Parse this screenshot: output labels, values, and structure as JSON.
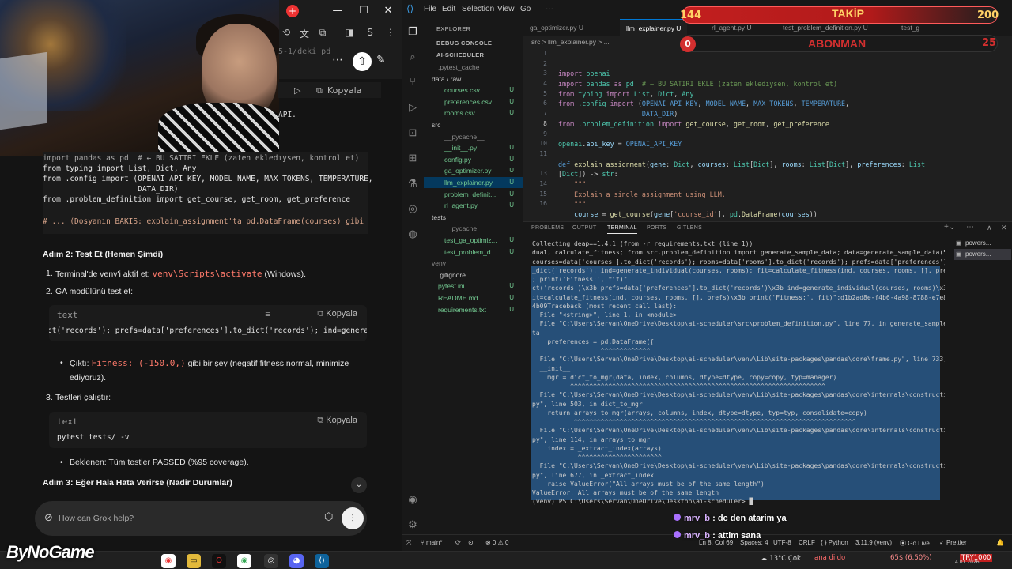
{
  "browser": {
    "win_min": "—",
    "win_max": "☐",
    "win_close": "✕",
    "fragment_pd": "5-1/deki pd",
    "fragment_api": "API.",
    "code1": {
      "copy_label": "Kopyala",
      "lines": [
        "import pandas as pd  # ← BU SATIRI EKLE (zaten ekledıysen, kontrol et)",
        "from typing import List, Dict, Any",
        "from .config import (OPENAI_API_KEY, MODEL_NAME, MAX_TOKENS, TEMPERATURE,",
        "                     DATA_DIR)",
        "from .problem_definition import get_course, get_room, get_preference"
      ],
      "comment": "# ... (Dosyanın BAKİS: explain_assignment'ta pd.DataFrame(courses) gibi yerle"
    },
    "step2": {
      "heading": "Adım 2: Test Et (Hemen Şimdi)",
      "item1_prefix": "Terminal'de venv'i aktif et:",
      "item1_code": "venv\\Scripts\\activate",
      "item1_suffix": "(Windows).",
      "item2": "GA modülünü test et:",
      "code_lang": "text",
      "copy_label": "Kopyala",
      "code_line": "ct('records'); prefs=data['preferences'].to_dict('records'); ind=generate_in",
      "bullet_prefix": "Çıktı:",
      "bullet_code": "Fitness: (-150.0,)",
      "bullet_suffix": "gibi bir şey (negatif fitness normal, minimize",
      "bullet_line2": "ediyoruz).",
      "item3": "Testleri çalıştır:",
      "code2_lang": "text",
      "code2_copy": "Kopyala",
      "code2_line": "pytest tests/ -v",
      "bullet2": "Beklenen: Tüm testler PASSED (%95 coverage)."
    },
    "step3_heading": "Adım 3: Eğer Hala Hata Verirse (Nadir Durumlar)",
    "chat_placeholder": "How can Grok help?"
  },
  "vscode": {
    "menu": [
      "File",
      "Edit",
      "Selection",
      "View",
      "Go"
    ],
    "explorer_title": "EXPLORER",
    "debug_console": "DEBUG CONSOLE",
    "project": "AI-SCHEDULER",
    "tree": [
      {
        "name": ".pytest_cache",
        "indent": 18,
        "cls": "grey",
        "status": ""
      },
      {
        "name": "data \\ raw",
        "indent": 10,
        "cls": "folder",
        "status": ""
      },
      {
        "name": "courses.csv",
        "indent": 26,
        "cls": "green",
        "status": "U"
      },
      {
        "name": "preferences.csv",
        "indent": 26,
        "cls": "green",
        "status": "U"
      },
      {
        "name": "rooms.csv",
        "indent": 26,
        "cls": "green",
        "status": "U"
      },
      {
        "name": "src",
        "indent": 10,
        "cls": "folder",
        "status": ""
      },
      {
        "name": "__pycache__",
        "indent": 26,
        "cls": "grey",
        "status": ""
      },
      {
        "name": "__init__.py",
        "indent": 26,
        "cls": "green",
        "status": "U"
      },
      {
        "name": "config.py",
        "indent": 26,
        "cls": "green",
        "status": "U"
      },
      {
        "name": "ga_optimizer.py",
        "indent": 26,
        "cls": "green",
        "status": "U"
      },
      {
        "name": "llm_explainer.py",
        "indent": 26,
        "cls": "green",
        "status": "U",
        "selected": true
      },
      {
        "name": "problem_definit...",
        "indent": 26,
        "cls": "green",
        "status": "U"
      },
      {
        "name": "rl_agent.py",
        "indent": 26,
        "cls": "green",
        "status": "U"
      },
      {
        "name": "tests",
        "indent": 10,
        "cls": "folder",
        "status": ""
      },
      {
        "name": "__pycache__",
        "indent": 26,
        "cls": "grey",
        "status": ""
      },
      {
        "name": "test_ga_optimiz...",
        "indent": 26,
        "cls": "green",
        "status": "U"
      },
      {
        "name": "test_problem_d...",
        "indent": 26,
        "cls": "green",
        "status": "U"
      },
      {
        "name": "venv",
        "indent": 10,
        "cls": "grey",
        "status": ""
      },
      {
        "name": ".gitignore",
        "indent": 18,
        "cls": "folder",
        "status": ""
      },
      {
        "name": "pytest.ini",
        "indent": 18,
        "cls": "green",
        "status": "U"
      },
      {
        "name": "README.md",
        "indent": 18,
        "cls": "green",
        "status": "U"
      },
      {
        "name": "requirements.txt",
        "indent": 18,
        "cls": "green",
        "status": "U"
      }
    ],
    "tabs": [
      "ga_optimizer.py U",
      "llm_explainer.py U",
      "rl_agent.py U",
      "test_problem_definition.py U",
      "test_g"
    ],
    "breadcrumb": "src > llm_explainer.py > ...",
    "line_numbers": [
      "1",
      "2",
      "3",
      "4",
      "5",
      "6",
      "7",
      "8",
      "9",
      "10",
      "11",
      "",
      "13",
      "14",
      "15",
      "16"
    ],
    "panel_tabs": [
      "PROBLEMS",
      "OUTPUT",
      "TERMINAL",
      "PORTS",
      "GITLENS"
    ],
    "terminal_lines": [
      "Collecting deap==1.4.1 (from -r requirements.txt (line 1))",
      "dual, calculate_fitness; from src.problem_definition import generate_sample_data; data=generate_sample_data(5);",
      "courses=data['courses'].to_dict('records'); rooms=data['rooms'].to_dict('records'); prefs=data['preferences'].to",
      "_dict('records'); ind=generate_individual(courses, rooms); fit=calculate_fitness(ind, courses, rooms, [], prefs)",
      "; print('Fitness:', fit)\"",
      "ct('records')\\x3b prefs=data['preferences'].to_dict('records')\\x3b ind=generate_individual(courses, rooms)\\x3b f",
      "it=calculate_fitness(ind, courses, rooms, [], prefs)\\x3b print('Fitness:', fit)\";d1b2ad8e-f4b6-4a98-8788-e7e830b",
      "4b09Traceback (most recent call last):",
      "  File \"<string>\", line 1, in <module>",
      "  File \"C:\\Users\\Servan\\OneDrive\\Desktop\\ai-scheduler\\src\\problem_definition.py\", line 77, in generate_sample_da",
      "ta",
      "    preferences = pd.DataFrame({",
      "                  ^^^^^^^^^^^^^",
      "  File \"C:\\Users\\Servan\\OneDrive\\Desktop\\ai-scheduler\\venv\\Lib\\site-packages\\pandas\\core\\frame.py\", line 733, in",
      "  __init__",
      "    mgr = dict_to_mgr(data, index, columns, dtype=dtype, copy=copy, typ=manager)",
      "          ^^^^^^^^^^^^^^^^^^^^^^^^^^^^^^^^^^^^^^^^^^^^^^^^^^^^^^^^^^^^^^^^^^^",
      "  File \"C:\\Users\\Servan\\OneDrive\\Desktop\\ai-scheduler\\venv\\Lib\\site-packages\\pandas\\core\\internals\\construction.",
      "py\", line 503, in dict_to_mgr",
      "    return arrays_to_mgr(arrays, columns, index, dtype=dtype, typ=typ, consolidate=copy)",
      "           ^^^^^^^^^^^^^^^^^^^^^^^^^^^^^^^^^^^^^^^^^^^^^^^^^^^^^^^^^^^^^^^^^^^^^^^^^^",
      "  File \"C:\\Users\\Servan\\OneDrive\\Desktop\\ai-scheduler\\venv\\Lib\\site-packages\\pandas\\core\\internals\\construction.",
      "py\", line 114, in arrays_to_mgr",
      "    index = _extract_index(arrays)",
      "            ^^^^^^^^^^^^^^^^^^^^^^",
      "  File \"C:\\Users\\Servan\\OneDrive\\Desktop\\ai-scheduler\\venv\\Lib\\site-packages\\pandas\\core\\internals\\construction.",
      "py\", line 677, in _extract_index",
      "    raise ValueError(\"All arrays must be of the same length\")",
      "ValueError: All arrays must be of the same length",
      "(venv) PS C:\\Users\\Servan\\OneDrive\\Desktop\\ai-scheduler> █"
    ],
    "terminal_list": [
      "powers...",
      "powers..."
    ],
    "status": {
      "branch": "main*",
      "errors": "⊗ 0 ⚠ 0",
      "position": "Ln 8, Col 69",
      "spaces": "Spaces: 4",
      "encoding": "UTF-8",
      "eol": "CRLF",
      "language": "{ } Python",
      "interpreter": "3.11.9 (venv)",
      "golive": "Go Live",
      "prettier": "Prettier"
    }
  },
  "overlay": {
    "follow_label": "TAKİP",
    "follow_current": "144",
    "follow_goal": "200",
    "sub_label": "ABONMAN",
    "sub_current": "0",
    "sub_goal": "25",
    "chat": [
      {
        "user": "mrv_b",
        "text": ": dc den atarim ya"
      },
      {
        "user": "mrv_b",
        "text": ": attim sana"
      }
    ]
  },
  "taskbar": {
    "brand": "ByNoGame",
    "weather": "13°C  Çok",
    "ticker_text": "ana dildo",
    "ticker_pct": "65$ (6.50%)",
    "ticker_try": "TRY1000",
    "date": "4.01.2026"
  }
}
